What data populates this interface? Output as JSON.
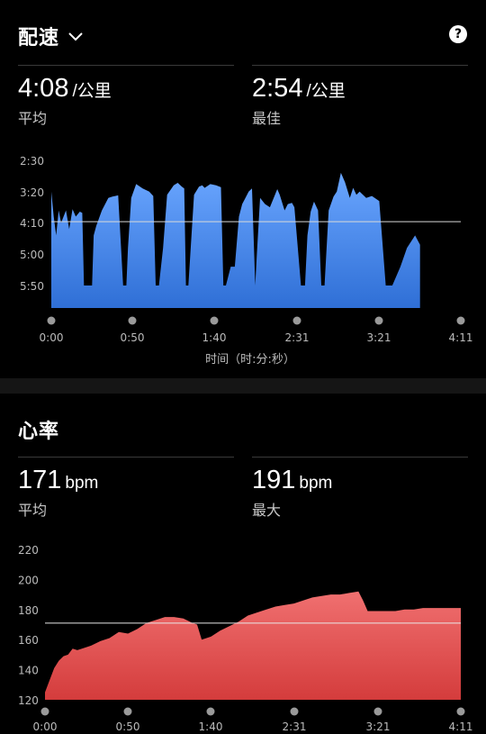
{
  "pace": {
    "title": "配速",
    "avg_value": "4:08",
    "avg_unit": "/公里",
    "avg_label": "平均",
    "best_value": "2:54",
    "best_unit": "/公里",
    "best_label": "最佳",
    "chart_data": {
      "type": "area",
      "y_tick_labels": [
        "2:30",
        "3:20",
        "4:10",
        "5:00",
        "5:50"
      ],
      "x_tick_labels": [
        "0:00",
        "0:50",
        "1:40",
        "2:31",
        "3:21",
        "4:11"
      ],
      "xlabel": "时间（时:分:秒）",
      "x_unit": "seconds",
      "y_unit": "seconds per km (inverted axis)",
      "reference_line": 248,
      "x": [
        0,
        3,
        6,
        9,
        12,
        15,
        18,
        22,
        26,
        30,
        35,
        38,
        40,
        45,
        50,
        52,
        55,
        62,
        70,
        75,
        82,
        88,
        92,
        94,
        98,
        104,
        112,
        120,
        125,
        128,
        132,
        137,
        142,
        150,
        155,
        160,
        163,
        165,
        168,
        175,
        181,
        185,
        188,
        195,
        202,
        208,
        211,
        214,
        220,
        225,
        230,
        234,
        238,
        242,
        246,
        250,
        252,
        256,
        262,
        268,
        274,
        277,
        280,
        286,
        290,
        295,
        298,
        306,
        311,
        314,
        318,
        322,
        327,
        331,
        335,
        340,
        346,
        350,
        355,
        360,
        366,
        370,
        374,
        378,
        386,
        393,
        402,
        410,
        418,
        428,
        436,
        446,
        452
      ],
      "y": [
        200,
        240,
        270,
        230,
        250,
        240,
        230,
        260,
        228,
        240,
        232,
        234,
        350,
        350,
        350,
        270,
        255,
        230,
        210,
        208,
        206,
        350,
        350,
        290,
        210,
        188,
        195,
        200,
        207,
        350,
        350,
        290,
        205,
        190,
        186,
        192,
        195,
        350,
        350,
        205,
        192,
        190,
        194,
        188,
        190,
        193,
        350,
        350,
        320,
        320,
        240,
        220,
        210,
        200,
        195,
        350,
        300,
        210,
        220,
        225,
        206,
        196,
        205,
        230,
        220,
        218,
        225,
        350,
        350,
        270,
        232,
        216,
        230,
        350,
        350,
        230,
        208,
        200,
        170,
        185,
        210,
        194,
        205,
        200,
        210,
        207,
        215,
        350,
        350,
        320,
        290,
        270,
        285,
        270,
        262,
        265,
        260,
        255
      ]
    }
  },
  "hr": {
    "title": "心率",
    "avg_value": "171",
    "avg_unit": "bpm",
    "avg_label": "平均",
    "max_value": "191",
    "max_unit": "bpm",
    "max_label": "最大",
    "chart_data": {
      "type": "area",
      "y_tick_labels": [
        "220",
        "200",
        "180",
        "160",
        "140",
        "120"
      ],
      "x_tick_labels": [
        "0:00",
        "0:50",
        "1:40",
        "2:31",
        "3:21",
        "4:11"
      ],
      "ylim": [
        120,
        220
      ],
      "x_unit": "seconds",
      "reference_line": 171,
      "x": [
        0,
        5,
        10,
        15,
        20,
        25,
        30,
        35,
        40,
        50,
        60,
        70,
        80,
        90,
        100,
        110,
        120,
        130,
        140,
        150,
        160,
        165,
        170,
        180,
        190,
        200,
        210,
        220,
        230,
        240,
        250,
        260,
        270,
        280,
        290,
        300,
        310,
        320,
        330,
        340,
        345,
        350,
        360,
        370,
        380,
        390,
        400,
        410,
        420,
        430,
        440,
        451
      ],
      "y": [
        125,
        133,
        141,
        146,
        149,
        150,
        154,
        153,
        154,
        156,
        159,
        161,
        165,
        164,
        167,
        171,
        173,
        175,
        175,
        174,
        171,
        170,
        160,
        162,
        166,
        169,
        172,
        176,
        178,
        180,
        182,
        183,
        184,
        186,
        188,
        189,
        190,
        190,
        191,
        192,
        186,
        179,
        179,
        179,
        179,
        180,
        180,
        181,
        181,
        181,
        181,
        181
      ]
    }
  }
}
